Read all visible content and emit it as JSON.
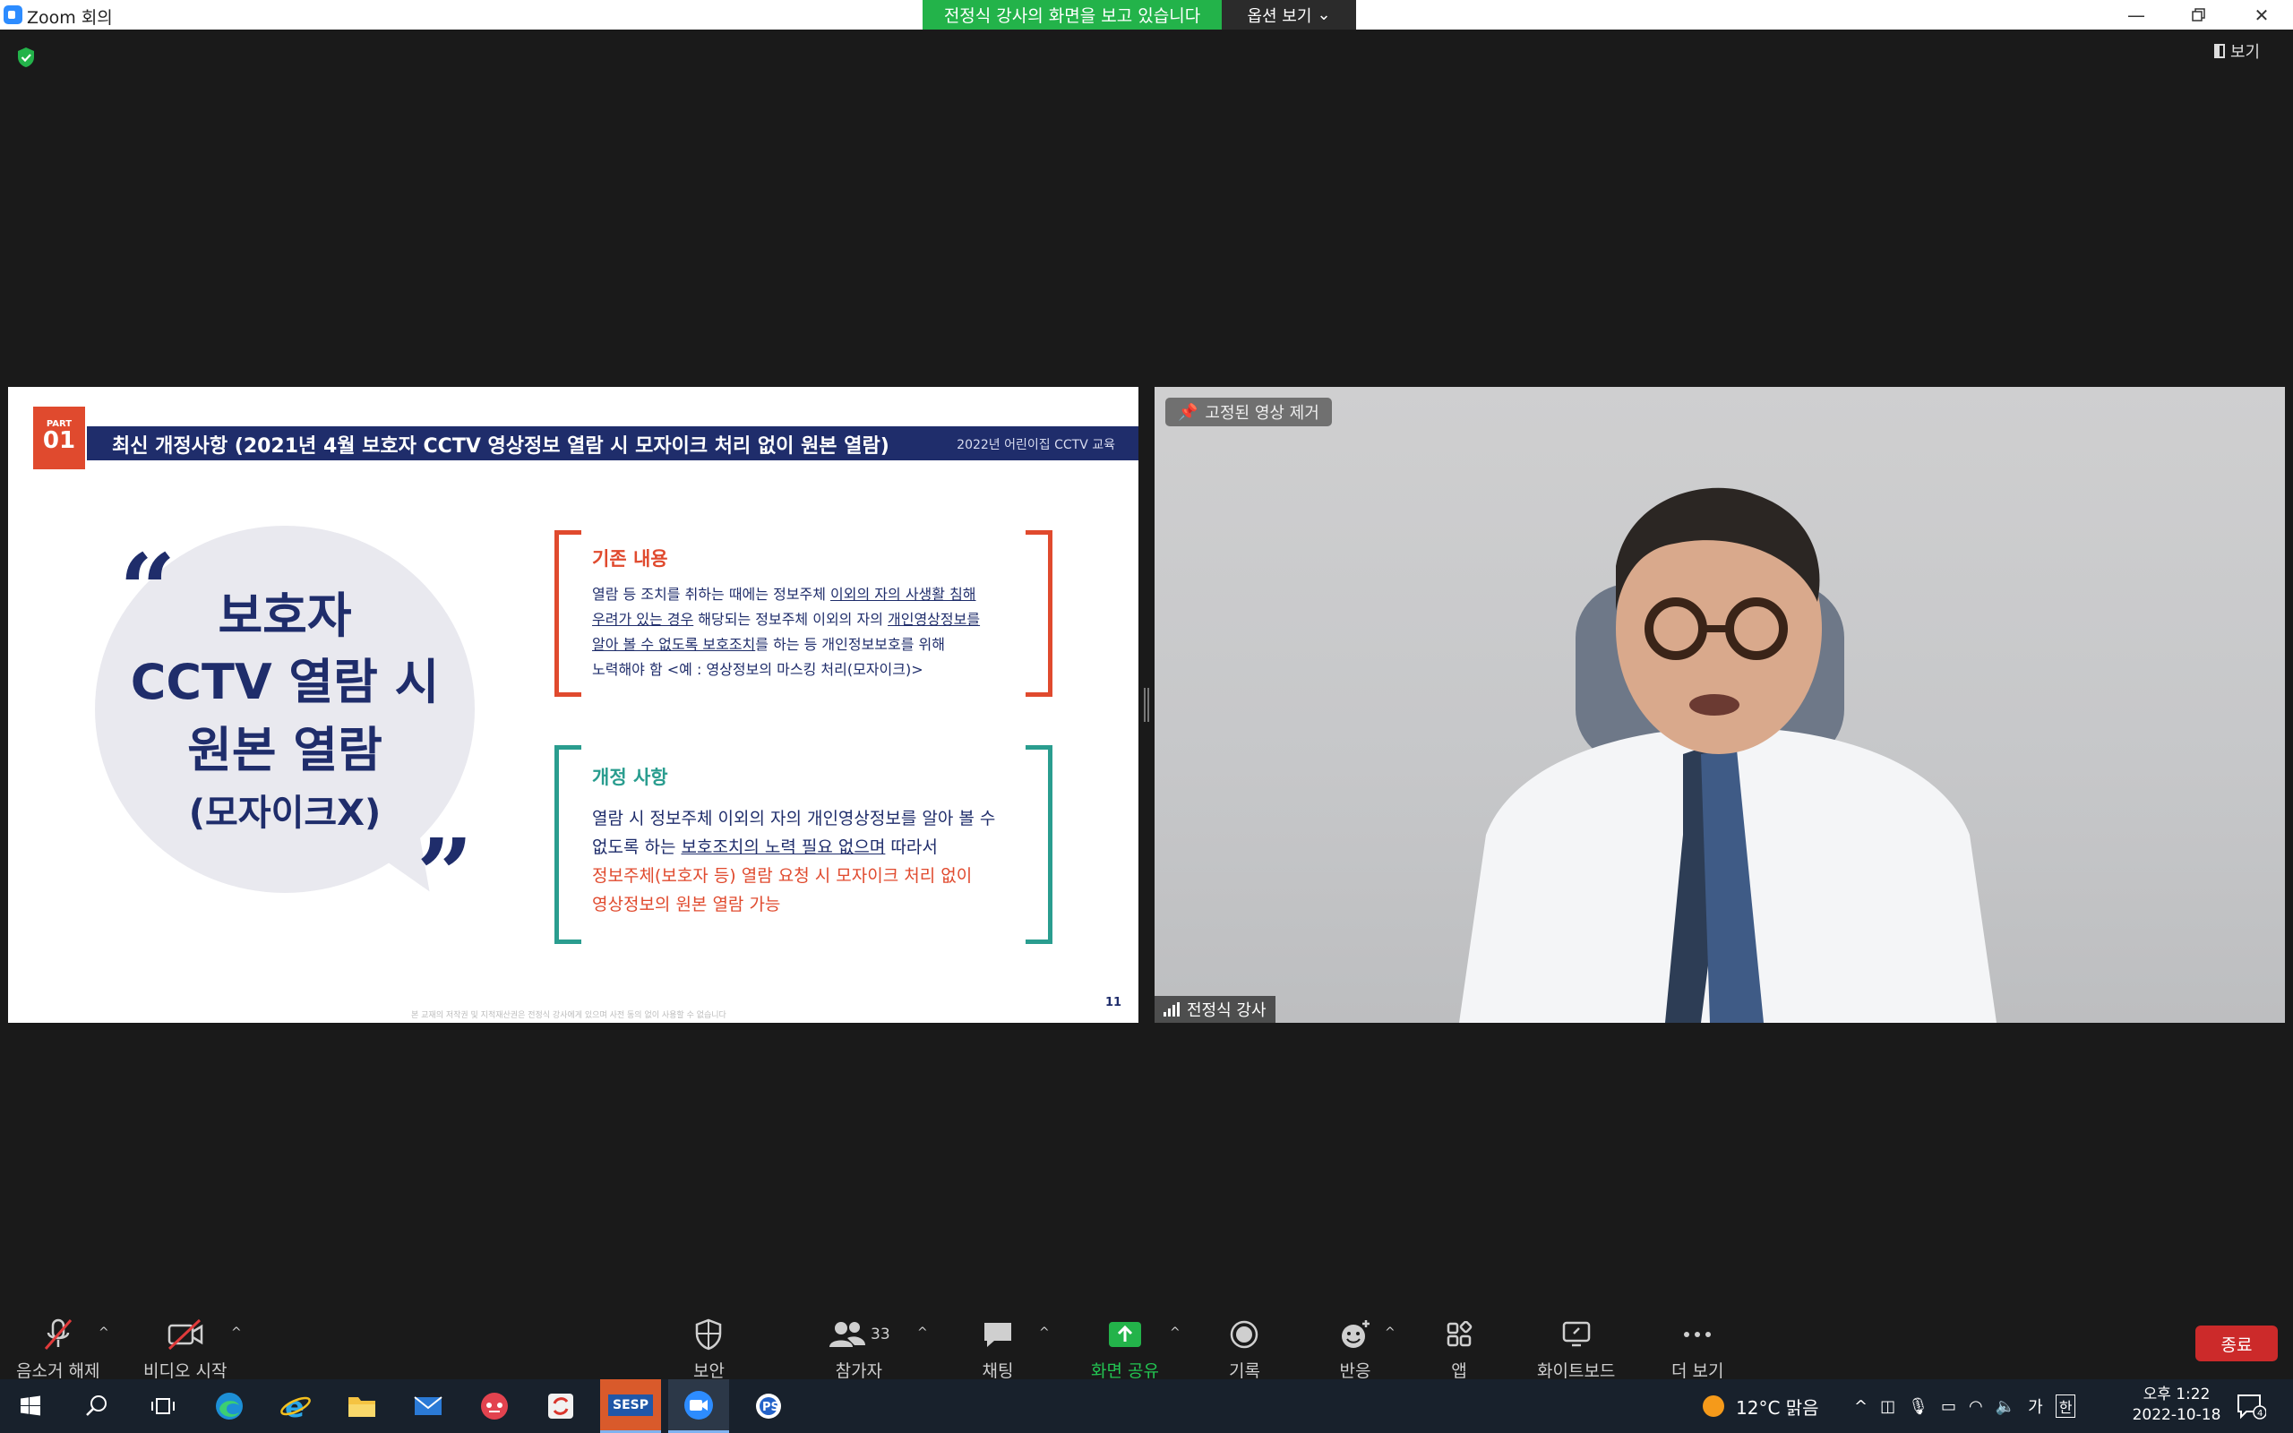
{
  "window": {
    "title": "Zoom 회의",
    "share_banner": "전정식 강사의 화면을 보고 있습니다",
    "view_options": "옵션 보기",
    "top_view_button": "보기"
  },
  "slide": {
    "part_label": "PART",
    "part_number": "01",
    "header_title": "최신 개정사항 (2021년 4월 보호자 CCTV 영상정보 열람 시 모자이크 처리 없이 원본 열람)",
    "header_sub": "2022년 어린이집 CCTV 교육",
    "quote_line1": "보호자",
    "quote_line2": "CCTV 열람 시",
    "quote_line3": "원본 열람",
    "quote_line4": "(모자이크X)",
    "old_title": "기존 내용",
    "old_body": {
      "a": "열람 등 조치를 취하는 때에는 정보주체 ",
      "b": "이외의 자의 사생활 침해",
      "c": "우려가 있는 경우",
      "d": " 해당되는 정보주체 이외의 자의 ",
      "e": "개인영상정보를",
      "f": "알아 볼 수 없도록 보호조치",
      "g": "를 하는 등 개인정보보호를 위해",
      "h": "노력해야 함 <예 : 영상정보의 마스킹 처리(모자이크)>"
    },
    "new_title": "개정 사항",
    "new_body": {
      "a": "열람 시 정보주체 이외의 자의 개인영상정보를 알아 볼 수",
      "b": "없도록 하는 ",
      "c": "보호조치의 노력 필요 없으며",
      "d": " 따라서",
      "e": "정보주체(보호자 등) 열람 요청 시 모자이크 처리 없이",
      "f": "영상정보의 원본 열람 가능"
    },
    "footer_note": "본 교재의 저작권 및 지적재산권은 전정식 강사에게 있으며 사전 동의 없이 사용할 수 없습니다",
    "page_number": "11"
  },
  "video": {
    "unpin_label": "고정된 영상 제거",
    "participant_name": "전정식 강사"
  },
  "toolbar": {
    "unmute": "음소거 해제",
    "start_video": "비디오 시작",
    "security": "보안",
    "participants": "참가자",
    "participants_count": "33",
    "chat": "채팅",
    "share_screen": "화면 공유",
    "record": "기록",
    "reactions": "반응",
    "apps": "앱",
    "whiteboard": "화이트보드",
    "more": "더 보기",
    "end": "종료"
  },
  "taskbar": {
    "sesp_label": "SESP",
    "weather": "12°C  맑음",
    "ime": "가",
    "hanja": "한",
    "time": "오후 1:22",
    "date": "2022-10-18",
    "notifications": "4"
  },
  "colors": {
    "share_green": "#23b34a",
    "slide_navy": "#1f2d6b",
    "slide_red": "#e04a2e",
    "slide_teal": "#2a9d8f",
    "end_red": "#cc2a2a"
  }
}
